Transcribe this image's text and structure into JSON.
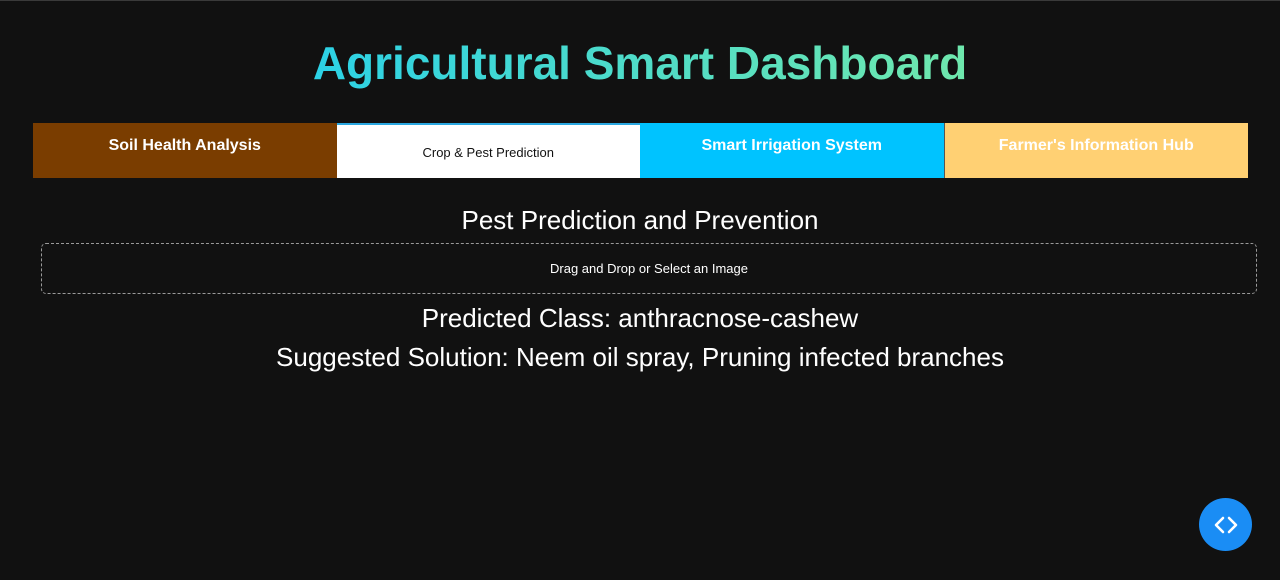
{
  "header": {
    "title": "Agricultural Smart Dashboard"
  },
  "tabs": [
    {
      "label": "Soil Health Analysis",
      "color": "#7a3d00",
      "selected": false
    },
    {
      "label": "Crop & Pest Prediction",
      "color": "#ffffff",
      "selected": true
    },
    {
      "label": "Smart Irrigation System",
      "color": "#00c3ff",
      "selected": false
    },
    {
      "label": "Farmer's Information Hub",
      "color": "#ffd073",
      "selected": false
    }
  ],
  "main": {
    "section_title": "Pest Prediction and Prevention",
    "upload_label": "Drag and Drop or Select an Image",
    "predicted_class": "Predicted Class: anthracnose-cashew",
    "suggested_solution": "Suggested Solution: Neem oil spray, Pruning infected branches"
  },
  "fab": {
    "icon": "code-icon",
    "color": "#1a8df5"
  },
  "theme": {
    "background": "#111111",
    "title_gradient": [
      "#2cd2e6",
      "#6fe8ad"
    ]
  }
}
